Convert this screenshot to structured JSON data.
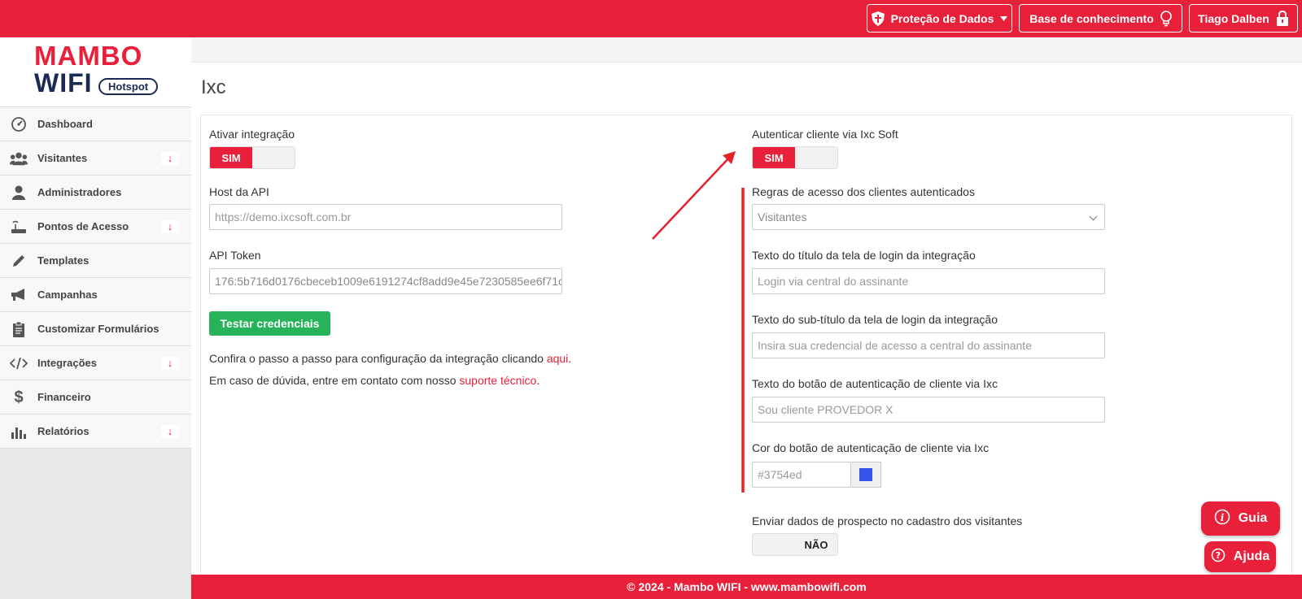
{
  "topbar": {
    "privacy_label": "Proteção de Dados",
    "knowledge_label": "Base de conhecimento",
    "user_label": "Tiago Dalben"
  },
  "logo": {
    "line1": "MAMBO",
    "line2": "WIFI",
    "badge": "Hotspot"
  },
  "sidebar": {
    "items": [
      {
        "label": "Dashboard",
        "icon": "dashboard-icon",
        "arrow": ""
      },
      {
        "label": "Visitantes",
        "icon": "users-icon",
        "arrow": "↓"
      },
      {
        "label": "Administradores",
        "icon": "user-icon",
        "arrow": ""
      },
      {
        "label": "Pontos de Acesso",
        "icon": "router-icon",
        "arrow": "↓"
      },
      {
        "label": "Templates",
        "icon": "pencil-icon",
        "arrow": ""
      },
      {
        "label": "Campanhas",
        "icon": "megaphone-icon",
        "arrow": ""
      },
      {
        "label": "Customizar Formulários",
        "icon": "clipboard-icon",
        "arrow": ""
      },
      {
        "label": "Integrações",
        "icon": "code-icon",
        "arrow": "↓"
      },
      {
        "label": "Financeiro",
        "icon": "dollar-icon",
        "arrow": ""
      },
      {
        "label": "Relatórios",
        "icon": "bar-chart-icon",
        "arrow": "↓"
      }
    ]
  },
  "main": {
    "title": "Ixc",
    "left": {
      "enable_label": "Ativar integração",
      "enable_toggle": "SIM",
      "host_label": "Host da API",
      "host_placeholder": "https://demo.ixcsoft.com.br",
      "token_label": "API Token",
      "token_value": "176:5b716d0176cbeceb1009e6191274cf8add9e45e7230585ee6f71c",
      "test_button": "Testar credenciais",
      "help_text_1": "Confira o passo a passo para configuração da integração clicando ",
      "help_link_1": "aqui",
      "help_text_1_end": ".",
      "help_text_2": "Em caso de dúvida, entre em contato com nosso ",
      "help_link_2": "suporte técnico",
      "help_text_2_end": "."
    },
    "right": {
      "auth_label": "Autenticar cliente via Ixc Soft",
      "auth_toggle": "SIM",
      "rules_label": "Regras de acesso dos clientes autenticados",
      "rules_value": "Visitantes",
      "title_label": "Texto do título da tela de login da integração",
      "title_placeholder": "Login via central do assinante",
      "subtitle_label": "Texto do sub-título da tela de login da integração",
      "subtitle_placeholder": "Insira sua credencial de acesso a central do assinante",
      "button_text_label": "Texto do botão de autenticação de cliente via Ixc",
      "button_text_placeholder": "Sou cliente PROVEDOR X",
      "color_label": "Cor do botão de autenticação de cliente via Ixc",
      "color_value": "#3754ed",
      "prospect_label": "Enviar dados de prospecto no cadastro dos visitantes",
      "prospect_toggle": "NÃO"
    }
  },
  "floating": {
    "guide_label": "Guia",
    "help_label": "Ajuda"
  },
  "footer": {
    "text": "© 2024 - Mambo WIFI - www.mambowifi.com"
  },
  "colors": {
    "brand": "#e8203a",
    "green": "#27b35a",
    "swatch": "#3754ed",
    "annotation": "#e8202a"
  }
}
